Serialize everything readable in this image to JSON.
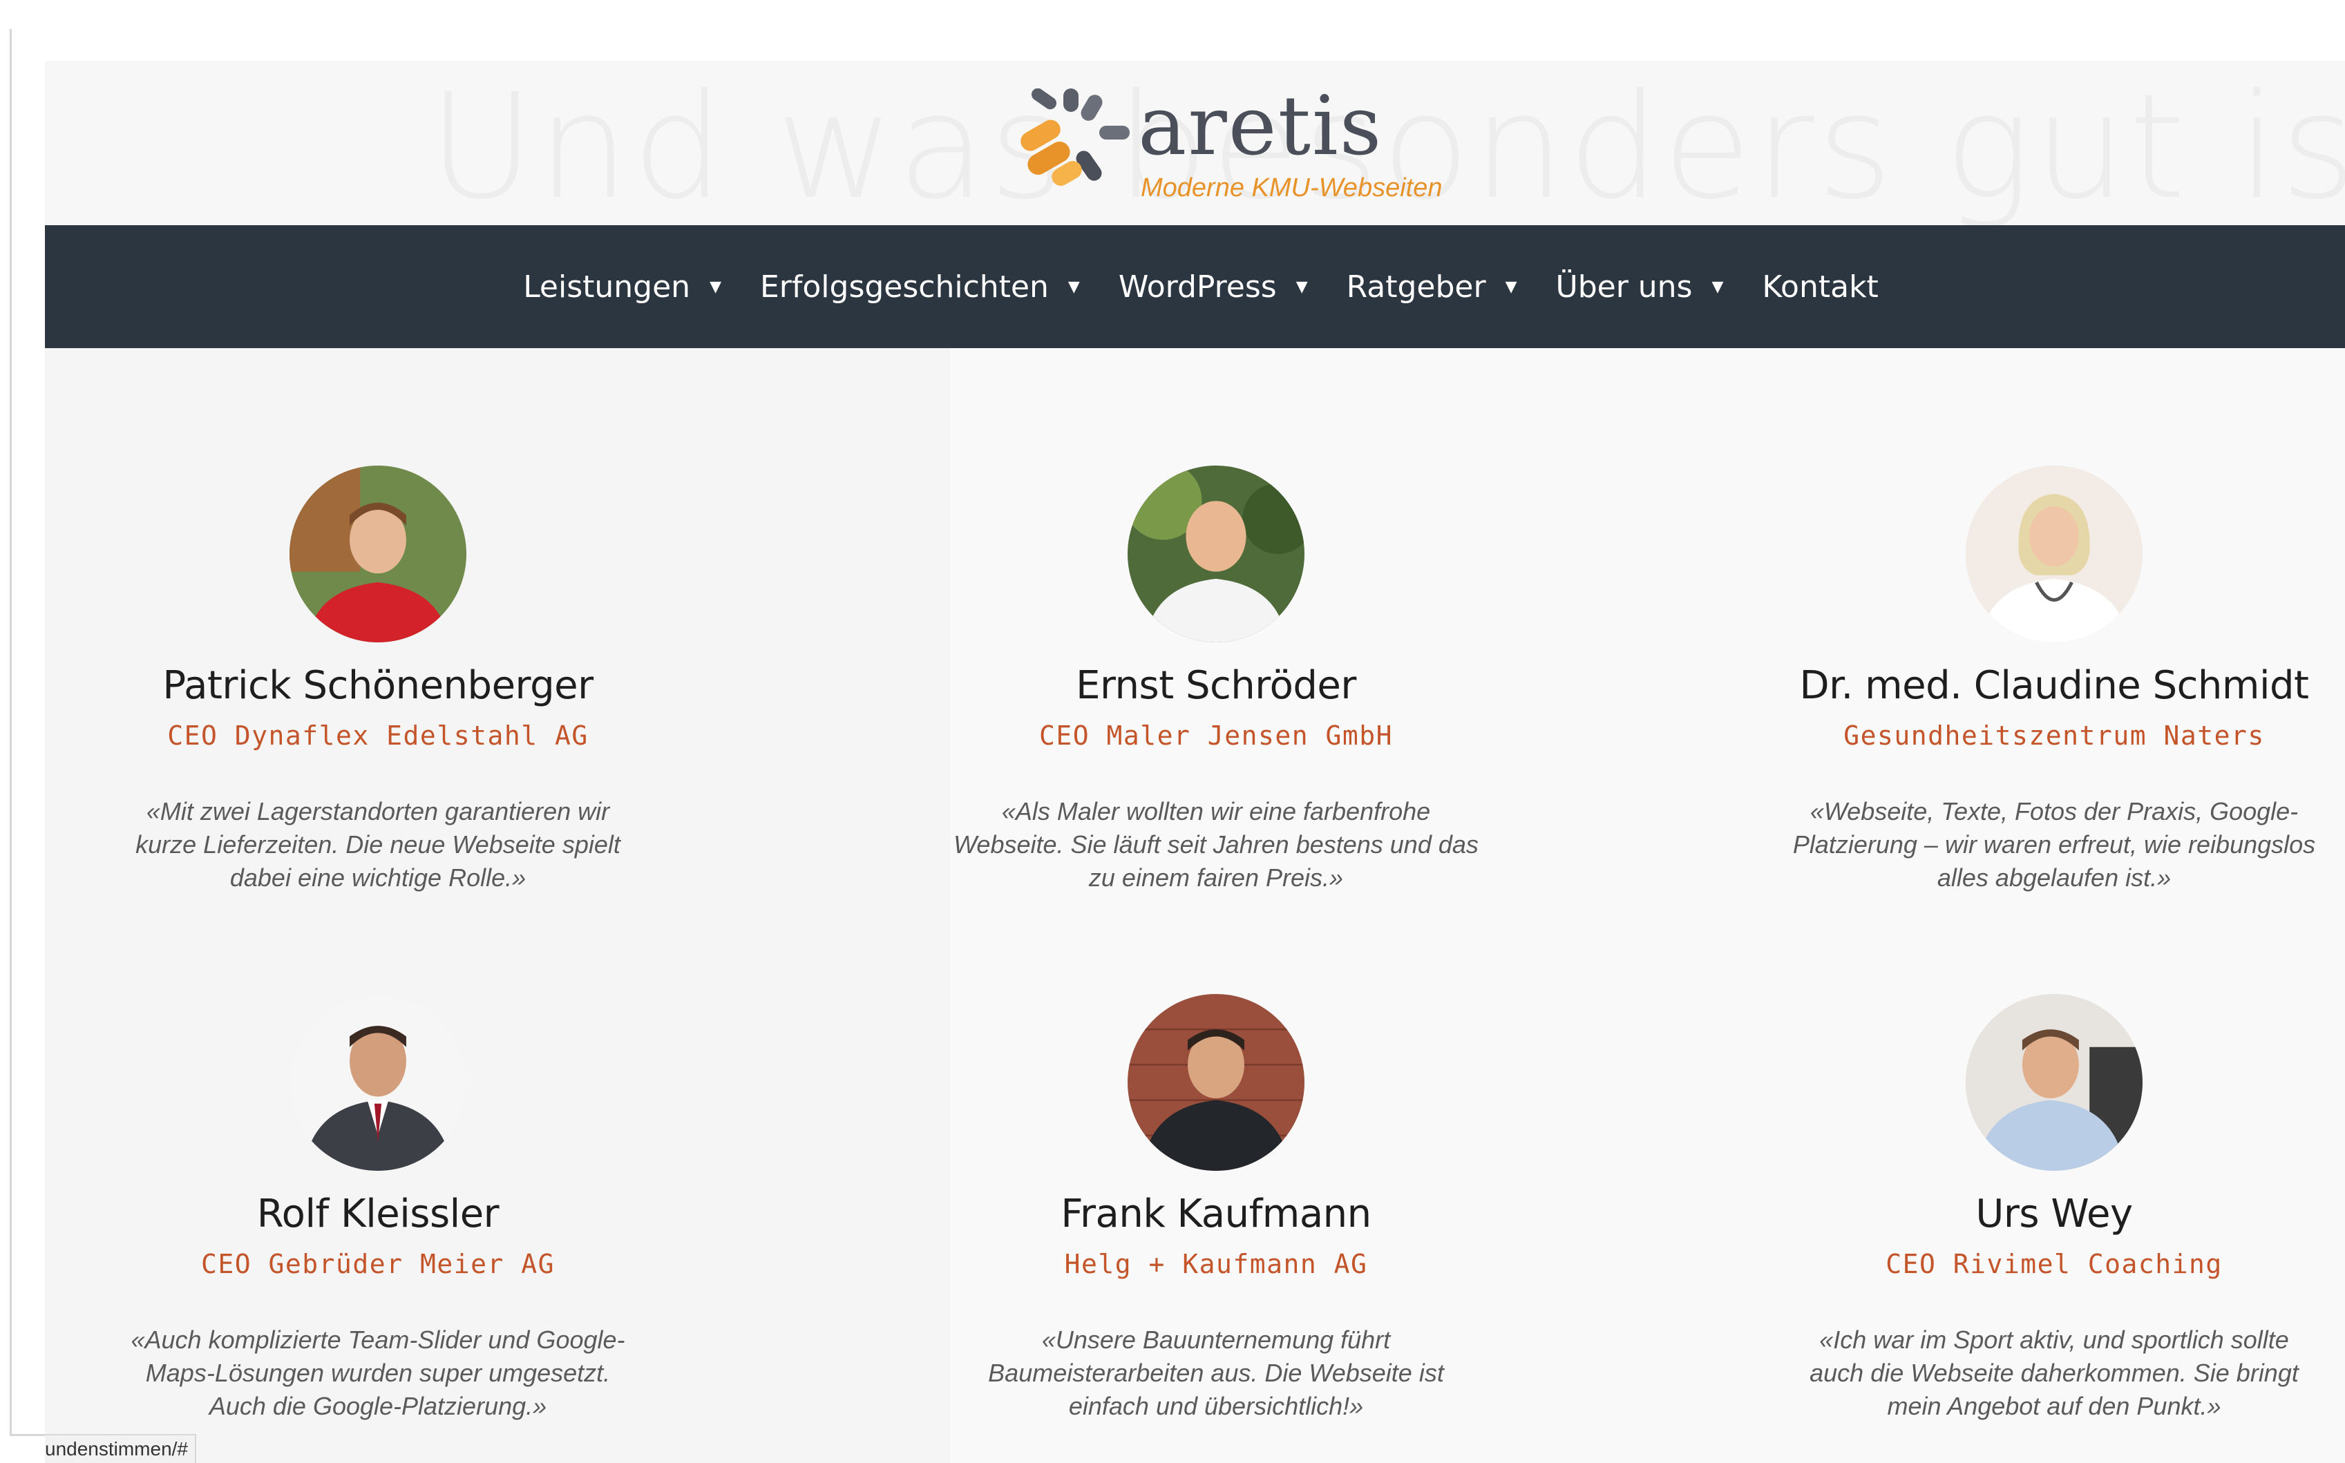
{
  "header": {
    "ghost_title": "Und was besonders gut ist",
    "logo": {
      "name": "aretis",
      "tagline": "Moderne KMU-Webseiten",
      "colors": {
        "text": "#4a4f5a",
        "accent": "#e8922a"
      }
    }
  },
  "nav": {
    "items": [
      {
        "label": "Leistungen",
        "has_dropdown": true,
        "icon": "caret-down-icon"
      },
      {
        "label": "Erfolgsgeschichten",
        "has_dropdown": true,
        "icon": "caret-down-icon"
      },
      {
        "label": "WordPress",
        "has_dropdown": true,
        "icon": "caret-down-icon"
      },
      {
        "label": "Ratgeber",
        "has_dropdown": true,
        "icon": "caret-down-icon"
      },
      {
        "label": "Über uns",
        "has_dropdown": true,
        "icon": "caret-down-icon"
      },
      {
        "label": "Kontakt",
        "has_dropdown": false
      }
    ],
    "background": "#2b3641"
  },
  "testimonials": [
    {
      "name": "Patrick Schönenberger",
      "role": "CEO Dynaflex Edelstahl AG",
      "quote": "«Mit zwei Lagerstandorten garantieren wir kurze Lieferzeiten. Die neue Webseite spielt dabei eine wichtige Rolle.»"
    },
    {
      "name": "Ernst Schröder",
      "role": "CEO Maler Jensen GmbH",
      "quote": "«Als Maler wollten wir eine farbenfrohe Webseite. Sie läuft seit Jahren bestens und das zu einem fairen Preis.»"
    },
    {
      "name": "Dr. med. Claudine Schmidt",
      "role": "Gesundheitszentrum Naters",
      "quote": "«Webseite, Texte, Fotos der Praxis, Google-Platzierung – wir waren erfreut, wie reibungslos alles abgelaufen ist.»"
    },
    {
      "name": "Rolf Kleissler",
      "role": "CEO Gebrüder Meier AG",
      "quote": "«Auch komplizierte Team-Slider und Google-Maps-Lösungen wurden super umgesetzt. Auch die Google-Platzierung.»"
    },
    {
      "name": "Frank Kaufmann",
      "role": "Helg + Kaufmann AG",
      "quote": "«Unsere Bauunternemung führt Baumeisterarbeiten aus. Die Webseite ist einfach und übersichtlich!»"
    },
    {
      "name": "Urs Wey",
      "role": "CEO Rivimel Coaching",
      "quote": "«Ich war im Sport aktiv, und sportlich sollte auch die Webseite daherkommen. Sie bringt mein Angebot auf den Punkt.»"
    }
  ],
  "status_bar": {
    "url": "undenstimmen/#"
  },
  "colors": {
    "role_text": "#c4552a",
    "name_text": "#1e1e1e",
    "quote_text": "#5a5a5a"
  }
}
